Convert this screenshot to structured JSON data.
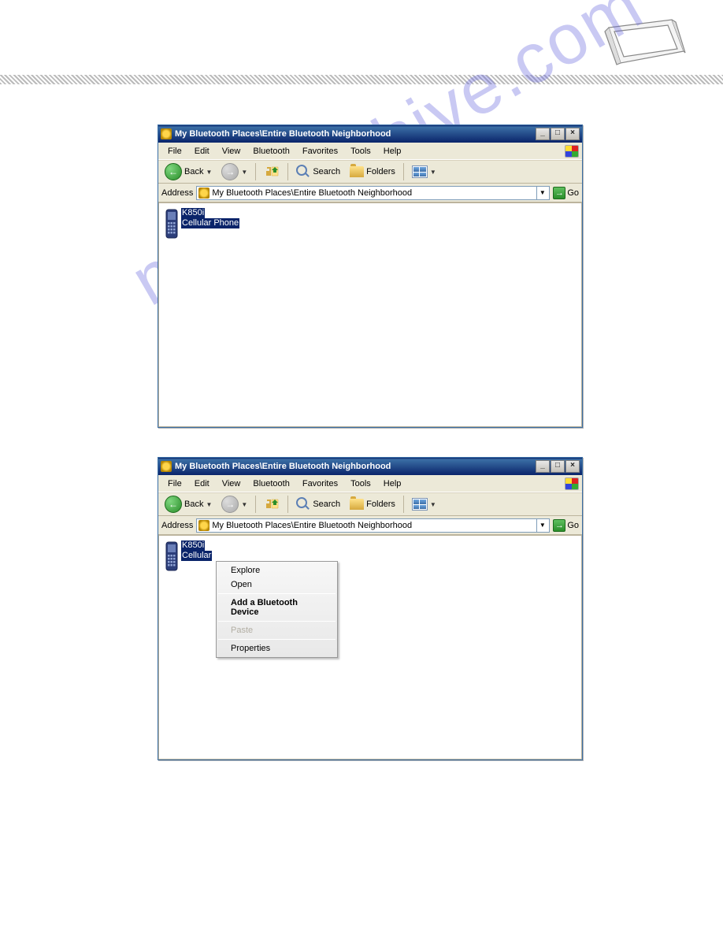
{
  "watermark": "manualshive.com",
  "window1": {
    "title": "My Bluetooth Places\\Entire Bluetooth Neighborhood",
    "titlebar_buttons": {
      "min": "_",
      "max": "□",
      "close": "×"
    },
    "menus": {
      "file": "File",
      "edit": "Edit",
      "view": "View",
      "bluetooth": "Bluetooth",
      "favorites": "Favorites",
      "tools": "Tools",
      "help": "Help"
    },
    "toolbar": {
      "back": "Back",
      "search": "Search",
      "folders": "Folders"
    },
    "addressbar": {
      "label": "Address",
      "value": "My Bluetooth Places\\Entire Bluetooth Neighborhood",
      "go": "Go"
    },
    "device": {
      "name": "K850i",
      "type": "Cellular Phone"
    }
  },
  "window2": {
    "title": "My Bluetooth Places\\Entire Bluetooth Neighborhood",
    "titlebar_buttons": {
      "min": "_",
      "max": "□",
      "close": "×"
    },
    "menus": {
      "file": "File",
      "edit": "Edit",
      "view": "View",
      "bluetooth": "Bluetooth",
      "favorites": "Favorites",
      "tools": "Tools",
      "help": "Help"
    },
    "toolbar": {
      "back": "Back",
      "search": "Search",
      "folders": "Folders"
    },
    "addressbar": {
      "label": "Address",
      "value": "My Bluetooth Places\\Entire Bluetooth Neighborhood",
      "go": "Go"
    },
    "device": {
      "name": "K850i",
      "type": "Cellular"
    },
    "context_menu": {
      "explore": "Explore",
      "open": "Open",
      "add": "Add a Bluetooth Device",
      "paste": "Paste",
      "properties": "Properties"
    }
  }
}
